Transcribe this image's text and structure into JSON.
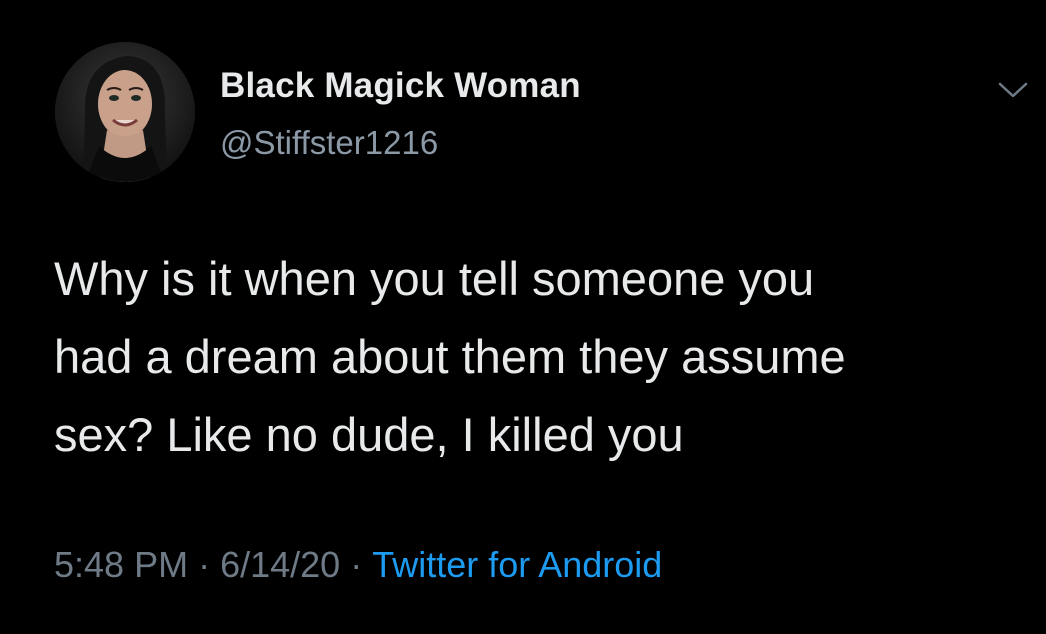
{
  "author": {
    "display_name": "Black Magick Woman",
    "handle": "@Stiffster1216"
  },
  "icons": {
    "avatar": "profile-photo",
    "menu": "chevron-down-icon"
  },
  "tweet": {
    "lines": [
      "Why is it when you tell someone you",
      "had a dream about them they assume",
      "sex? Like no dude, I killed you"
    ]
  },
  "meta": {
    "time": "5:48 PM",
    "separator": "·",
    "date": "6/14/20",
    "source": "Twitter for Android"
  },
  "colors": {
    "background": "#000000",
    "text": "#e7e9ea",
    "secondary": "#8b98a5",
    "link": "#1d9bf0"
  }
}
